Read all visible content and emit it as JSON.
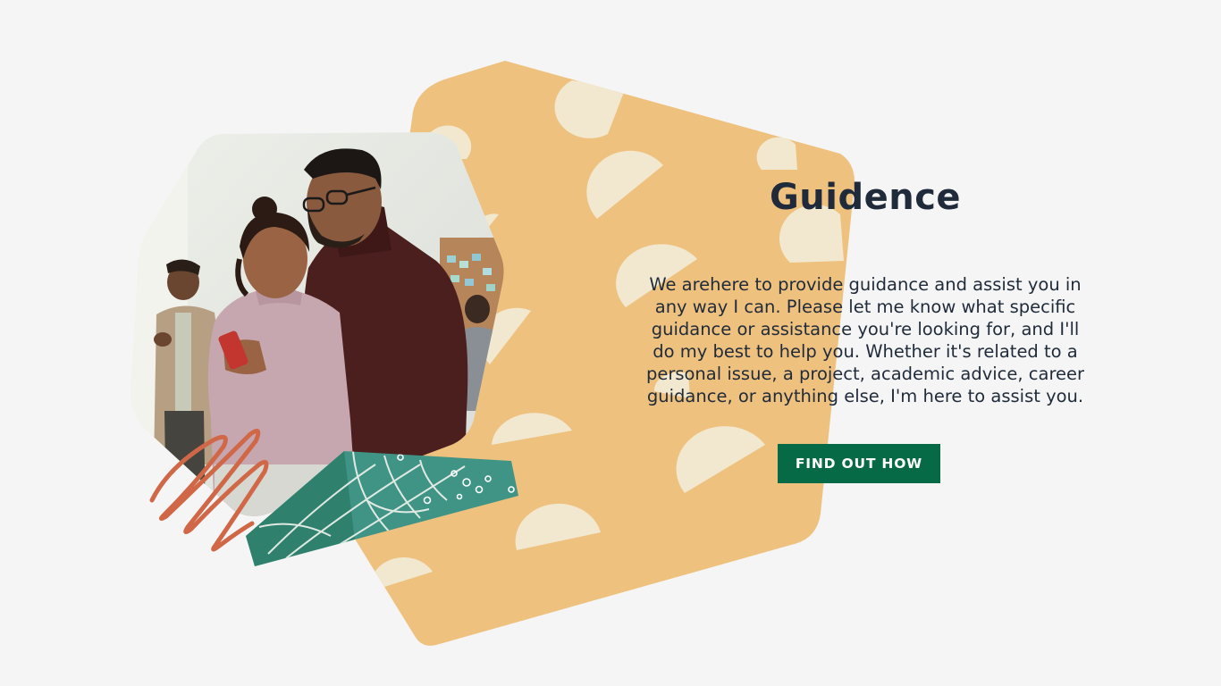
{
  "heading": "Guidence",
  "body_text": "We arehere to provide guidance and assist you in any way I can. Please let me know what specific guidance or assistance you're looking for, and I'll do my best to help you. Whether it's related to a personal issue, a project, academic advice, career guidance, or anything else, I'm here to assist you.",
  "cta_label": "FIND OUT HOW",
  "colors": {
    "background": "#f5f5f5",
    "blob": "#efc17e",
    "blob_dots": "#f1e8cf",
    "heading_text": "#1f2b3a",
    "button": "#076a47",
    "button_text": "#ffffff",
    "scribble": "#d06848",
    "teal_patch": "#3f9486"
  },
  "images": {
    "photo": "two-people-looking-at-phone-photo"
  }
}
